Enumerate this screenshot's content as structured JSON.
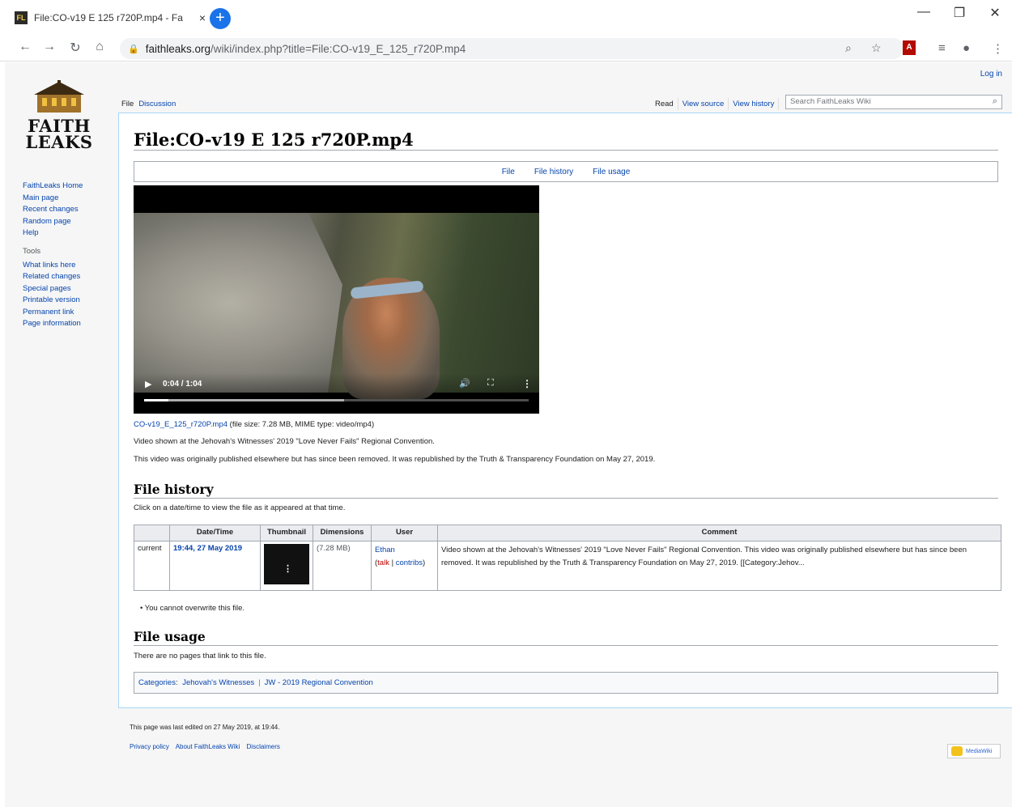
{
  "browser": {
    "tab_title": "File:CO-v19 E 125 r720P.mp4 - Fa",
    "favicon_text": "FL",
    "tab_close": "×",
    "new_tab": "+",
    "url_host": "faithleaks.org",
    "url_path": "/wiki/index.php?title=File:CO-v19_E_125_r720P.mp4",
    "minimize": "—",
    "restore": "❐",
    "close": "✕"
  },
  "site": {
    "logo_line1": "FAITH",
    "logo_line2": "LEAKS",
    "login": "Log in"
  },
  "sidebar": {
    "nav_items": [
      {
        "label": "FaithLeaks Home"
      },
      {
        "label": "Main page"
      },
      {
        "label": "Recent changes"
      },
      {
        "label": "Random page"
      },
      {
        "label": "Help"
      }
    ],
    "tools_heading": "Tools",
    "tools_items": [
      {
        "label": "What links here"
      },
      {
        "label": "Related changes"
      },
      {
        "label": "Special pages"
      },
      {
        "label": "Printable version"
      },
      {
        "label": "Permanent link"
      },
      {
        "label": "Page information"
      }
    ]
  },
  "tabs": {
    "left": [
      {
        "label": "File"
      },
      {
        "label": "Discussion"
      }
    ],
    "right": [
      {
        "label": "Read"
      },
      {
        "label": "View source"
      },
      {
        "label": "View history"
      }
    ]
  },
  "search": {
    "placeholder": "Search FaithLeaks Wiki"
  },
  "page": {
    "title": "File:CO-v19 E 125 r720P.mp4",
    "file_nav": [
      "File",
      "File history",
      "File usage"
    ],
    "video": {
      "time_display": "0:04 / 1:04",
      "progress_fraction": 0.0625,
      "buffered_fraction": 0.52
    },
    "file_link": "CO-v19_E_125_r720P.mp4",
    "file_info": " (file size: 7.28 MB, MIME type: video/mp4)",
    "desc1": "Video shown at the Jehovah's Witnesses' 2019 \"Love Never Fails\" Regional Convention.",
    "desc2": "This video was originally published elsewhere but has since been removed. It was republished by the Truth & Transparency Foundation on May 27, 2019.",
    "history_heading": "File history",
    "history_instruction": "Click on a date/time to view the file as it appeared at that time.",
    "history_table": {
      "headers": [
        "",
        "Date/Time",
        "Thumbnail",
        "Dimensions",
        "User",
        "Comment"
      ],
      "row": {
        "status": "current",
        "datetime": "19:44, 27 May 2019",
        "dimensions": "(7.28 MB)",
        "user": "Ethan",
        "user_talk": "talk",
        "user_sep": " | ",
        "user_contribs": "contribs",
        "paren_open": "(",
        "paren_close": ")",
        "comment": "Video shown at the Jehovah's Witnesses' 2019 \"Love Never Fails\" Regional Convention. This video was originally published elsewhere but has since been removed. It was republished by the Truth & Transparency Foundation on May 27, 2019. [[Category:Jehov..."
      }
    },
    "overwrite_note": "You cannot overwrite this file.",
    "usage_heading": "File usage",
    "usage_text": "There are no pages that link to this file.",
    "categories_label": "Categories",
    "categories_colon": ":",
    "categories": [
      "Jehovah's Witnesses",
      "JW - 2019 Regional Convention"
    ]
  },
  "footer": {
    "last_edited": "This page was last edited on 27 May 2019, at 19:44.",
    "links": [
      "Privacy policy",
      "About FaithLeaks Wiki",
      "Disclaimers"
    ],
    "badge": "MediaWiki"
  },
  "colors": {
    "link": "#0645ad",
    "tab_accent": "#1a73e8",
    "border": "#a2a9b1"
  }
}
